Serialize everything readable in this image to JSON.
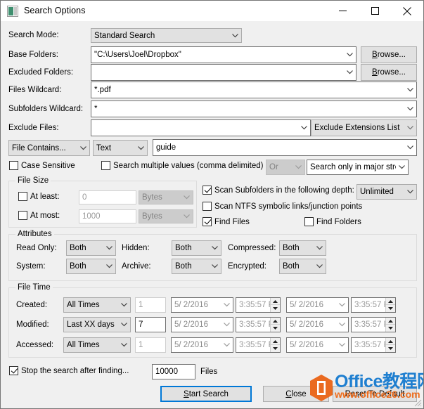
{
  "window": {
    "title": "Search Options",
    "icon": "app-window-icon",
    "minimize": "minimize-icon",
    "maximize": "maximize-icon",
    "close": "close-icon"
  },
  "form": {
    "search_mode": {
      "label": "Search Mode:",
      "value": "Standard Search"
    },
    "base_folders": {
      "label": "Base Folders:",
      "value": "\"C:\\Users\\Joel\\Dropbox\"",
      "browse": "Browse..."
    },
    "excluded_folders": {
      "label": "Excluded Folders:",
      "value": "",
      "browse": "Browse..."
    },
    "files_wildcard": {
      "label": "Files Wildcard:",
      "value": "*.pdf"
    },
    "subfolders_wildcard": {
      "label": "Subfolders Wildcard:",
      "value": "*"
    },
    "exclude_files": {
      "label": "Exclude Files:",
      "value": "",
      "extensions_list": "Exclude Extensions List"
    },
    "contains": {
      "mode": "File Contains...",
      "type": "Text",
      "value": "guide"
    },
    "case_sensitive": {
      "label": "Case Sensitive",
      "checked": false
    },
    "search_multiple": {
      "label": "Search multiple values (comma delimited)",
      "checked": false
    },
    "operator": {
      "value": "Or",
      "disabled": true
    },
    "stream_scope": {
      "value": "Search only in major stre"
    }
  },
  "file_size": {
    "title": "File Size",
    "at_least": {
      "label": "At least:",
      "checked": false,
      "value": "0",
      "unit": "Bytes"
    },
    "at_most": {
      "label": "At most:",
      "checked": false,
      "value": "1000",
      "unit": "Bytes"
    }
  },
  "scan": {
    "subfolders": {
      "label": "Scan Subfolders in the following depth:",
      "checked": true,
      "depth": "Unlimited"
    },
    "ntfs_links": {
      "label": "Scan NTFS symbolic links/junction points",
      "checked": false
    },
    "find_files": {
      "label": "Find Files",
      "checked": true
    },
    "find_folders": {
      "label": "Find Folders",
      "checked": false
    }
  },
  "attributes": {
    "title": "Attributes",
    "rows": [
      {
        "label": "Read Only:",
        "value": "Both"
      },
      {
        "label": "Hidden:",
        "value": "Both"
      },
      {
        "label": "Compressed:",
        "value": "Both"
      },
      {
        "label": "System:",
        "value": "Both"
      },
      {
        "label": "Archive:",
        "value": "Both"
      },
      {
        "label": "Encrypted:",
        "value": "Both"
      }
    ]
  },
  "file_time": {
    "title": "File Time",
    "rows": [
      {
        "label": "Created:",
        "mode": "All Times",
        "num": "1",
        "date_from": "5/ 2/2016",
        "time_from": "3:35:57 P",
        "date_to": "5/ 2/2016",
        "time_to": "3:35:57 P",
        "num_enabled": false
      },
      {
        "label": "Modified:",
        "mode": "Last XX days",
        "num": "7",
        "date_from": "5/ 2/2016",
        "time_from": "3:35:57 P",
        "date_to": "5/ 2/2016",
        "time_to": "3:35:57 P",
        "num_enabled": true
      },
      {
        "label": "Accessed:",
        "mode": "All Times",
        "num": "1",
        "date_from": "5/ 2/2016",
        "time_from": "3:35:57 P",
        "date_to": "5/ 2/2016",
        "time_to": "3:35:57 P",
        "num_enabled": false
      }
    ]
  },
  "footer": {
    "stop_after": {
      "label": "Stop the search after finding...",
      "checked": true
    },
    "stop_count": "10000",
    "files_label": "Files",
    "start_search": "Start Search",
    "close": "Close",
    "reset": "Reset To Default"
  },
  "watermark": {
    "brand_en": "Office",
    "brand_cn": "教程网",
    "url": "www.office26.com"
  },
  "colors": {
    "accent": "#0078d7",
    "window_bg": "#f0f0f0",
    "watermark_blue": "#1f7fd0",
    "watermark_orange": "#ef6c1a"
  }
}
